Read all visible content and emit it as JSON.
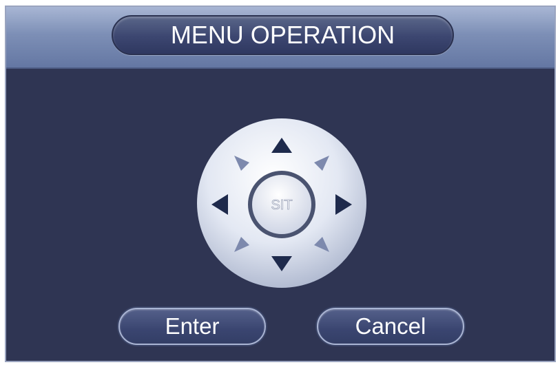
{
  "dialog": {
    "title": "MENU OPERATION"
  },
  "dpad": {
    "center_label": "SIT",
    "arrows": [
      "up",
      "down",
      "left",
      "right",
      "up-left",
      "up-right",
      "down-left",
      "down-right"
    ]
  },
  "buttons": {
    "enter_label": "Enter",
    "cancel_label": "Cancel"
  },
  "colors": {
    "panel_background": "#2f3553",
    "header_background": "#7d8fb6",
    "title_text": "#ffffff",
    "dpad_arrow": "#1e2a4c",
    "dpad_diagonal_arrow": "#7d89ad"
  }
}
